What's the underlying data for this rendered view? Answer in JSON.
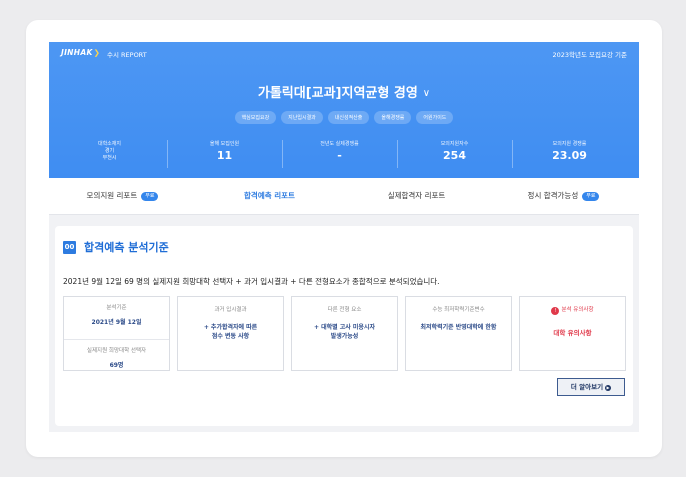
{
  "header": {
    "logo": "JINHAK",
    "report_label": "수시 REPORT",
    "year_info": "2023학년도 모집요강 기준"
  },
  "title": {
    "university": "가톨릭대[교과]지역균형 경영"
  },
  "pills": [
    "핵심모집요강",
    "지난입시결과",
    "내신성적산출",
    "올해경쟁률",
    "어원가이드"
  ],
  "stats": [
    {
      "label": "대학소재지",
      "line1": "경기",
      "line2": "부천시"
    },
    {
      "label": "올해 모집인원",
      "value": "11"
    },
    {
      "label": "전년도 실제경쟁률",
      "value": "-"
    },
    {
      "label": "모의지원자수",
      "value": "254"
    },
    {
      "label": "모의지원 경쟁률",
      "value": "23.09"
    }
  ],
  "tabs": [
    {
      "label": "모의지원 리포트",
      "badge": "무료"
    },
    {
      "label": "합격예측 리포트",
      "badge": ""
    },
    {
      "label": "실제합격자 리포트",
      "badge": ""
    },
    {
      "label": "정시 합격가능성",
      "badge": "무료"
    }
  ],
  "section": {
    "number": "00",
    "title": "합격예측 분석기준",
    "description": "2021년 9월 12일 69 명의 실제지원 희망대학 선택자 + 과거 입시결과 + 다른 전형요소가 종합적으로 분석되었습니다."
  },
  "boxes": {
    "basis_label": "분석기준",
    "basis_value": "2021년 9월 12일",
    "applicants_label": "실제지원 희망대학 선택자",
    "applicants_value": "69명",
    "past_label": "과거 입시결과",
    "past_line1": "+ 추가합격자에 따른",
    "past_line2": "점수 변동 사항",
    "other_label": "다른 전형 요소",
    "other_line1": "+ 대학별 고사 미응시자",
    "other_line2": "발생가능성",
    "suneung_label": "수능 최저학력기준변수",
    "suneung_value": "최저학력기준 반영대학에 한함",
    "warn_label": "분석 유의사항",
    "warn_value": "대학 유의사항"
  },
  "more_button": "더 알아보기"
}
